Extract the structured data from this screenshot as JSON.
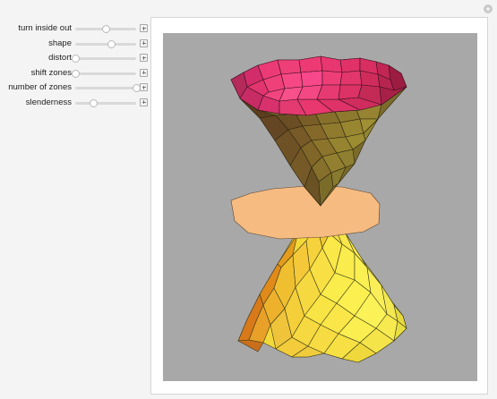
{
  "controls": [
    {
      "label": "turn inside out",
      "value": 0.5
    },
    {
      "label": "shape",
      "value": 0.6
    },
    {
      "label": "distort",
      "value": 0.0
    },
    {
      "label": "shift zones",
      "value": 0.0
    },
    {
      "label": "number of zones",
      "value": 1.0
    },
    {
      "label": "slenderness",
      "value": 0.3
    }
  ],
  "colors": {
    "background": "#a8a8a8",
    "top_rim": "#e8336f",
    "top_cone": "#7a6a28",
    "middle_disk": "#f6bb80",
    "bottom_cone": "#f2d52a"
  }
}
